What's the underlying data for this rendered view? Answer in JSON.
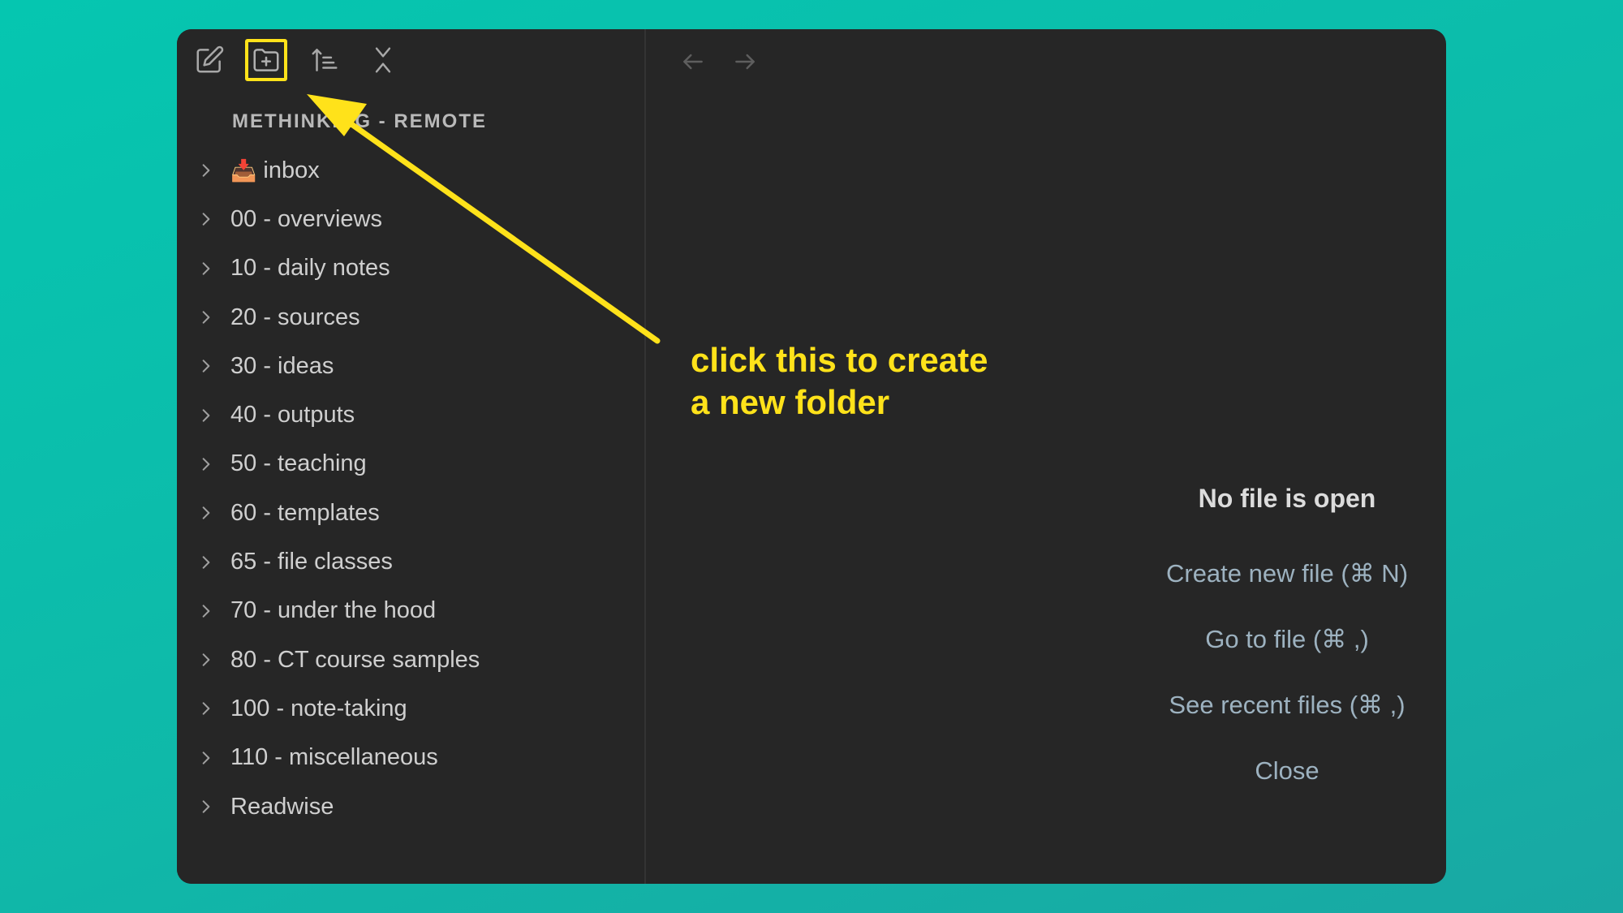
{
  "sidebar": {
    "vault_name": "METHINKING - REMOTE",
    "toolbar": {
      "new_note_icon": "edit-icon",
      "new_folder_icon": "folder-plus-icon",
      "sort_icon": "sort-icon",
      "collapse_icon": "collapse-all-icon"
    },
    "items": [
      {
        "label": "inbox",
        "emoji": "📥"
      },
      {
        "label": "00 - overviews"
      },
      {
        "label": "10 - daily notes"
      },
      {
        "label": "20 - sources"
      },
      {
        "label": "30 - ideas"
      },
      {
        "label": "40 - outputs"
      },
      {
        "label": "50 - teaching"
      },
      {
        "label": "60 - templates"
      },
      {
        "label": "65 - file classes"
      },
      {
        "label": "70 - under the hood"
      },
      {
        "label": "80 - CT course samples"
      },
      {
        "label": "100 - note-taking"
      },
      {
        "label": "110 - miscellaneous"
      },
      {
        "label": "Readwise"
      }
    ]
  },
  "main": {
    "empty_title": "No file is open",
    "actions": [
      "Create new file (⌘ N)",
      "Go to file (⌘ ,)",
      "See recent files (⌘ ,)",
      "Close"
    ]
  },
  "annotation": {
    "line1": "click this to create",
    "line2": "a new folder",
    "color": "#ffe21a"
  }
}
